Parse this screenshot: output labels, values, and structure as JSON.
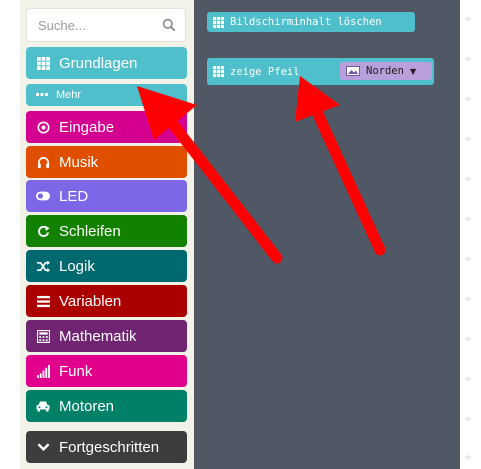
{
  "search": {
    "placeholder": "Suche..."
  },
  "categories": [
    {
      "label": "Grundlagen",
      "color": "#4fbfcc",
      "icon": "grid-icon"
    },
    {
      "label": "Mehr",
      "color": "#4fbfcc",
      "icon": "more-dots-icon"
    },
    {
      "label": "Eingabe",
      "color": "#d4008f",
      "icon": "target-icon"
    },
    {
      "label": "Musik",
      "color": "#e04f00",
      "icon": "headphones-icon"
    },
    {
      "label": "LED",
      "color": "#7c67e6",
      "icon": "toggle-icon"
    },
    {
      "label": "Schleifen",
      "color": "#128100",
      "icon": "refresh-icon"
    },
    {
      "label": "Logik",
      "color": "#006970",
      "icon": "shuffle-icon"
    },
    {
      "label": "Variablen",
      "color": "#aa0000",
      "icon": "list-icon"
    },
    {
      "label": "Mathematik",
      "color": "#712472",
      "icon": "calculator-icon"
    },
    {
      "label": "Funk",
      "color": "#e0008c",
      "icon": "signal-bars-icon"
    },
    {
      "label": "Motoren",
      "color": "#008066",
      "icon": "car-icon"
    },
    {
      "label": "Fortgeschritten",
      "color": "#3d3d3d",
      "icon": "chevron-down-icon"
    }
  ],
  "workspace": {
    "block_clear": "Bildschirminhalt löschen",
    "block_arrow": "zeige Pfeil",
    "arrow_direction": "Norden"
  }
}
